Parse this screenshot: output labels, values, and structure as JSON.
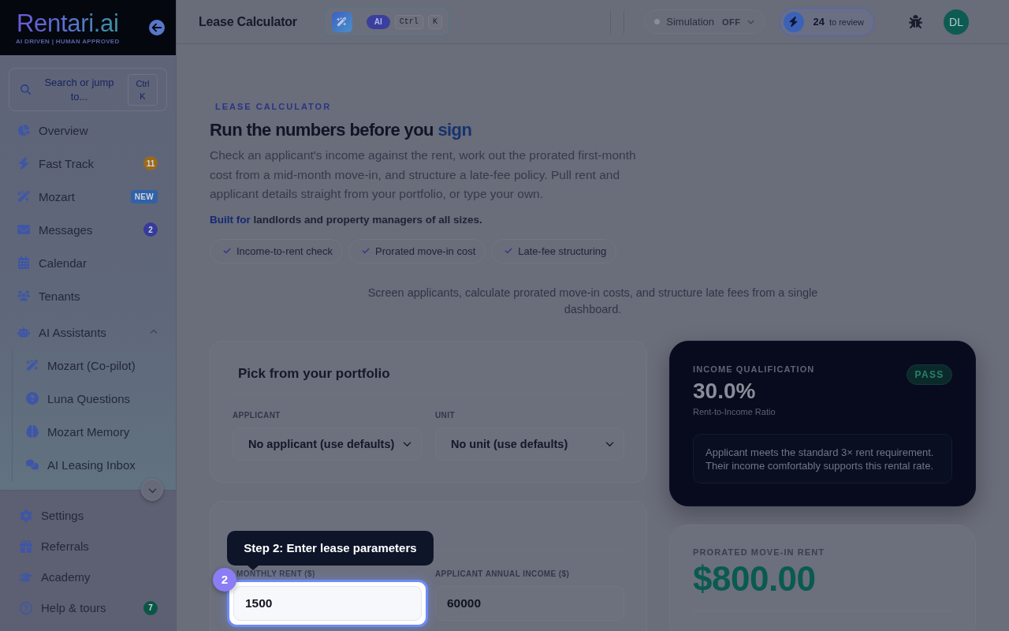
{
  "sidebar": {
    "logo": {
      "wordmark": "Rentari.ai",
      "tagline": "AI DRIVEN | HUMAN APPROVED"
    },
    "search": {
      "placeholder": "Search or jump to...",
      "shortcut": "Ctrl K"
    },
    "items": [
      {
        "kind": "link",
        "label": "Overview"
      },
      {
        "kind": "link",
        "label": "Fast Track",
        "badge": {
          "kind": "count",
          "text": "11",
          "color": "#9a6a1a"
        }
      },
      {
        "kind": "link",
        "label": "Mozart",
        "badge": {
          "kind": "tag",
          "text": "NEW",
          "color": "#2f62a8"
        }
      },
      {
        "kind": "link",
        "label": "Messages",
        "badge": {
          "kind": "count",
          "text": "2",
          "color": "#363a9a"
        }
      },
      {
        "kind": "link",
        "label": "Calendar"
      },
      {
        "kind": "link",
        "label": "Tenants"
      },
      {
        "kind": "group",
        "label": "AI Assistants",
        "expanded": true,
        "children": [
          {
            "label": "Mozart (Co-pilot)"
          },
          {
            "label": "Luna Questions"
          },
          {
            "label": "Mozart Memory"
          },
          {
            "label": "AI Leasing Inbox"
          }
        ]
      }
    ],
    "footer_items": [
      {
        "label": "Settings"
      },
      {
        "label": "Referrals"
      },
      {
        "label": "Academy"
      },
      {
        "label": "Help & tours",
        "badge": {
          "kind": "count",
          "text": "7",
          "color": "#0b5547"
        }
      }
    ]
  },
  "topbar": {
    "title": "Lease Calculator",
    "ai_command": {
      "badge": "AI",
      "keys": [
        "Ctrl",
        "K"
      ]
    },
    "simulation": {
      "label": "Simulation",
      "state_text": "OFF",
      "on": false
    },
    "review": {
      "count": "24",
      "label": "to review"
    },
    "avatar": {
      "initials": "DL"
    }
  },
  "hero": {
    "eyebrow": "LEASE CALCULATOR",
    "title": "Run the numbers before you",
    "title_accent": "sign",
    "description": "Check an applicant's income against the rent, work out the prorated first-month cost from a mid-month move-in, and structure a late-fee policy. Pull rent and applicant details straight from your portfolio, or type your own.",
    "audience_accent": "Built for",
    "audience": "landlords and property managers of all sizes.",
    "features": [
      "Income-to-rent check",
      "Prorated move-in cost",
      "Late-fee structuring"
    ],
    "subtitle": "Screen applicants, calculate prorated move-in costs, and structure late fees from a single dashboard."
  },
  "portfolio": {
    "title": "Pick from your portfolio",
    "fields": [
      {
        "label": "APPLICANT",
        "value": "No applicant (use defaults)"
      },
      {
        "label": "UNIT",
        "value": "No unit (use defaults)"
      }
    ]
  },
  "lease_parameters": {
    "fields": [
      {
        "label": "MONTHLY RENT ($)",
        "value": "1500",
        "highlighted": true
      },
      {
        "label": "APPLICANT ANNUAL INCOME ($)",
        "value": "60000",
        "highlighted": false
      }
    ]
  },
  "tour": {
    "step": "2",
    "text": "Step 2: Enter lease parameters"
  },
  "income_qualification": {
    "label": "INCOME QUALIFICATION",
    "value": "30.0%",
    "caption": "Rent-to-Income Ratio",
    "status": {
      "kind": "pass",
      "text": "PASS"
    },
    "note": "Applicant meets the standard 3× rent requirement. Their income comfortably supports this rental rate."
  },
  "prorated": {
    "label": "PRORATED MOVE-IN RENT",
    "value": "$800.00"
  }
}
